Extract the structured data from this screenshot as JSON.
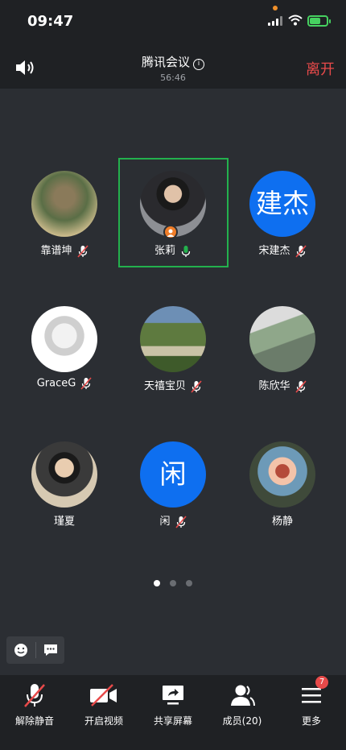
{
  "status": {
    "time": "09:47"
  },
  "meeting": {
    "title": "腾讯会议",
    "duration": "56:46",
    "leave_label": "离开"
  },
  "participants": [
    {
      "name": "靠谱坤",
      "avatar": "photo",
      "mic": "muted"
    },
    {
      "name": "张莉",
      "avatar": "photo",
      "mic": "active",
      "speaking": true,
      "host": true
    },
    {
      "name": "宋建杰",
      "avatar": "text",
      "avatar_text": "建杰",
      "mic": "muted"
    },
    {
      "name": "GraceG",
      "avatar": "photo",
      "mic": "muted"
    },
    {
      "name": "天禧宝贝",
      "avatar": "photo",
      "mic": "muted"
    },
    {
      "name": "陈欣华",
      "avatar": "photo",
      "mic": "muted"
    },
    {
      "name": "瑾夏",
      "avatar": "photo",
      "mic": "none"
    },
    {
      "name": "闲",
      "avatar": "text",
      "avatar_text": "闲",
      "mic": "muted"
    },
    {
      "name": "杨静",
      "avatar": "photo",
      "mic": "none"
    }
  ],
  "pagination": {
    "pages": 3,
    "current": 1
  },
  "toolbar": {
    "unmute": "解除静音",
    "start_video": "开启视频",
    "share_screen": "共享屏幕",
    "members": "成员(20)",
    "more": "更多",
    "more_badge": "7"
  },
  "colors": {
    "accent": "#0e6ff0",
    "speaking": "#23b14d",
    "leave": "#e84a4a",
    "muted": "#e84a4a"
  }
}
